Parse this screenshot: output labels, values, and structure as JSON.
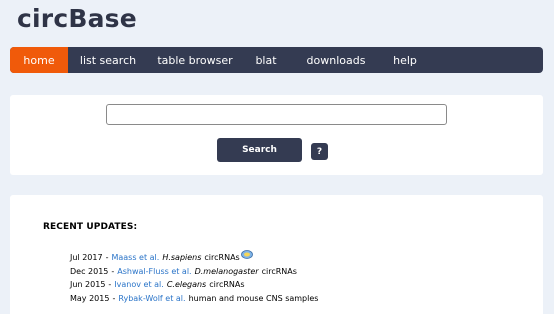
{
  "app": {
    "logo": "circBase"
  },
  "nav": {
    "items": [
      {
        "label": "home",
        "active": true
      },
      {
        "label": "list search",
        "active": false
      },
      {
        "label": "table browser",
        "active": false
      },
      {
        "label": "blat",
        "active": false
      },
      {
        "label": "downloads",
        "active": false
      },
      {
        "label": "help",
        "active": false
      }
    ]
  },
  "search": {
    "value": "",
    "placeholder": "",
    "button_label": "Search",
    "help_label": "?"
  },
  "updates": {
    "title": "RECENT UPDATES:",
    "items": [
      {
        "date": "Jul 2017",
        "author": "Maass et al.",
        "species": "H.sapiens",
        "desc": "circRNAs",
        "icon": "new-badge-icon"
      },
      {
        "date": "Dec 2015",
        "author": "Ashwal-Fluss et al.",
        "species": "D.melanogaster",
        "desc": "circRNAs"
      },
      {
        "date": "Jun 2015",
        "author": "Ivanov et al.",
        "species": "C.elegans",
        "desc": "circRNAs"
      },
      {
        "date": "May 2015",
        "author": "Rybak-Wolf et al.",
        "species": "",
        "desc": "human and mouse CNS samples"
      }
    ]
  },
  "colors": {
    "background": "#ecf1f8",
    "nav": "#343b52",
    "nav_active": "#f05a0a",
    "link": "#2a74c8"
  }
}
